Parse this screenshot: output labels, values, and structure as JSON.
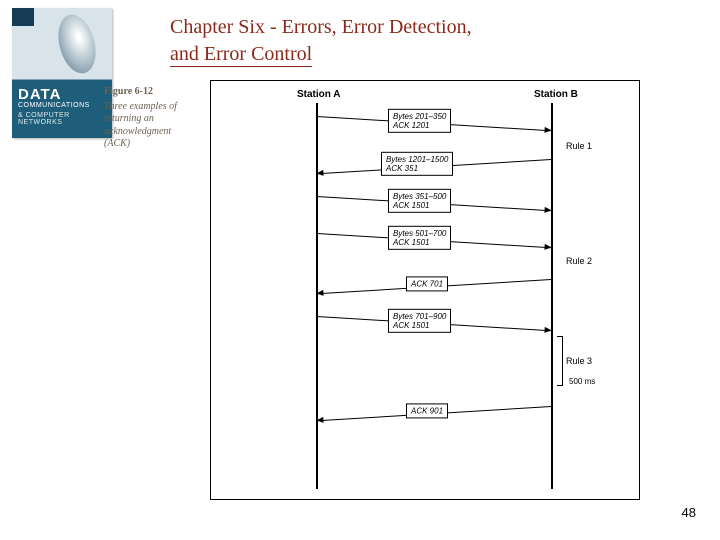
{
  "book": {
    "title_line1": "DATA",
    "title_line2": "COMMUNICATIONS",
    "title_line3": "& COMPUTER NETWORKS"
  },
  "chapter": {
    "title_line1": "Chapter Six - Errors, Error Detection,",
    "title_line2": "and Error Control"
  },
  "figure": {
    "number": "Figure 6-12",
    "description": "Three examples of returning an acknowledgment (ACK)"
  },
  "diagram": {
    "station_a": "Station A",
    "station_b": "Station B",
    "messages": [
      {
        "line1": "Bytes 201–350",
        "line2": "ACK 1201"
      },
      {
        "line1": "Bytes 1201–1500",
        "line2": "ACK 351"
      },
      {
        "line1": "Bytes 351–500",
        "line2": "ACK 1501"
      },
      {
        "line1": "Bytes 501–700",
        "line2": "ACK 1501"
      },
      {
        "line1": "ACK 701",
        "line2": ""
      },
      {
        "line1": "Bytes 701–900",
        "line2": "ACK 1501"
      },
      {
        "line1": "ACK 901",
        "line2": ""
      }
    ],
    "rules": [
      "Rule 1",
      "Rule 2",
      "Rule 3"
    ],
    "delay_label": "500 ms"
  },
  "page_number": "48"
}
